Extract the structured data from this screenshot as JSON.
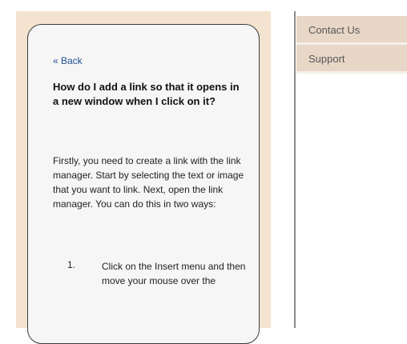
{
  "help": {
    "back_label": "« Back",
    "question": "How do I add a link so that it opens in a new window when I click on it?",
    "answer": "Firstly, you need to create a link with the link manager. Start by selecting the text or image that you want to link. Next, open the link manager. You can do this in two ways:",
    "steps": [
      {
        "number": "1.",
        "text": "Click on the Insert menu and then move your mouse over the"
      }
    ]
  },
  "menu": {
    "items": [
      {
        "label": "Contact Us"
      },
      {
        "label": "Support"
      }
    ]
  },
  "colors": {
    "panel_background": "#f3e3cf",
    "menu_background": "#e8d7c7",
    "link_color": "#23508f"
  }
}
